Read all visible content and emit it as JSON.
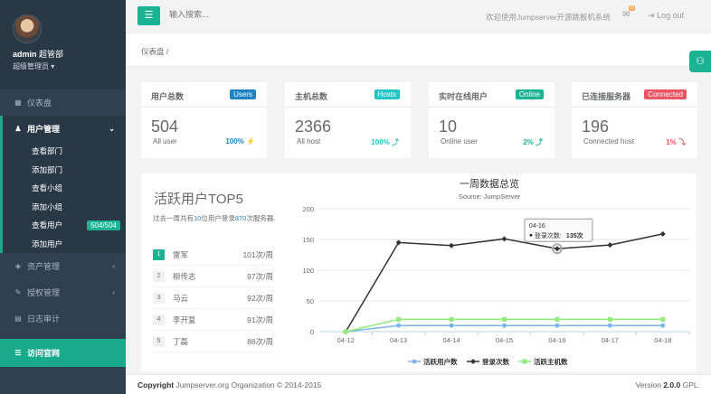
{
  "profile": {
    "name": "admin",
    "dept": "超管部",
    "role": "超级管理员"
  },
  "sidebar": {
    "dashboard": "仪表盘",
    "user_mgmt": "用户管理",
    "sub_items": [
      {
        "label": "查看部门",
        "badge": ""
      },
      {
        "label": "添加部门",
        "badge": ""
      },
      {
        "label": "查看小组",
        "badge": ""
      },
      {
        "label": "添加小组",
        "badge": ""
      },
      {
        "label": "查看用户",
        "badge": "504/504"
      },
      {
        "label": "添加用户",
        "badge": ""
      }
    ],
    "asset_mgmt": "资产管理",
    "perm_mgmt": "授权管理",
    "audit": "日志审计",
    "official": "访问官网"
  },
  "topbar": {
    "search_placeholder": "输入搜索...",
    "welcome": "欢迎使用Jumpserver开源跳板机系统",
    "mail_count": "0",
    "logout": "Log out"
  },
  "breadcrumb": "仪表盘 /",
  "cards": [
    {
      "title": "用户总数",
      "label": "Users",
      "label_color": "#1c84c6",
      "value": "504",
      "sub": "All user",
      "pct": "100%",
      "pct_icon": "⚡",
      "pct_color": "#1c84c6"
    },
    {
      "title": "主机总数",
      "label": "Hosts",
      "label_color": "#23c6c8",
      "value": "2366",
      "sub": "All host",
      "pct": "100%",
      "pct_icon": "⤴",
      "pct_color": "#23c6c8"
    },
    {
      "title": "实时在线用户",
      "label": "Online",
      "label_color": "#1ab394",
      "value": "10",
      "sub": "Online user",
      "pct": "2%",
      "pct_icon": "⤴",
      "pct_color": "#1ab394"
    },
    {
      "title": "已连接服务器",
      "label": "Connected",
      "label_color": "#ed5565",
      "value": "196",
      "sub": "Connected host",
      "pct": "1%",
      "pct_icon": "⤵",
      "pct_color": "#ed5565"
    }
  ],
  "top5": {
    "title": "活跃用户TOP5",
    "desc_pre": "过去一周共有",
    "desc_users": "10",
    "desc_mid": "位用户登录",
    "desc_times": "870",
    "desc_post": "次服务器.",
    "rows": [
      {
        "rank": "1",
        "name": "雷军",
        "count": "101次/周"
      },
      {
        "rank": "2",
        "name": "柳传志",
        "count": "97次/周"
      },
      {
        "rank": "3",
        "name": "马云",
        "count": "92次/周"
      },
      {
        "rank": "4",
        "name": "李开复",
        "count": "91次/周"
      },
      {
        "rank": "5",
        "name": "丁磊",
        "count": "88次/周"
      }
    ]
  },
  "chart_data": {
    "type": "line",
    "title": "一周数据总览",
    "subtitle": "Source: JumpServer",
    "categories": [
      "04-12",
      "04-13",
      "04-14",
      "04-15",
      "04-16",
      "04-17",
      "04-18"
    ],
    "ylim": [
      0,
      200
    ],
    "yticks": [
      0,
      50,
      100,
      150,
      200
    ],
    "grid": true,
    "legend_position": "bottom",
    "series": [
      {
        "name": "活跃用户数",
        "color": "#7cb5ec",
        "values": [
          0,
          10,
          10,
          10,
          10,
          10,
          10
        ]
      },
      {
        "name": "登录次数",
        "color": "#2f3439",
        "values": [
          0,
          145,
          140,
          151,
          135,
          141,
          159
        ]
      },
      {
        "name": "活跃主机数",
        "color": "#90ed7d",
        "values": [
          0,
          20,
          20,
          20,
          20,
          20,
          20
        ]
      }
    ],
    "tooltip": {
      "category": "04-16",
      "series": "登录次数",
      "label": "登录次数:",
      "value": "135次"
    }
  },
  "footer": {
    "copyright_pre": "Copyright",
    "copyright_text": "Jumpserver.org Organization © 2014-2015",
    "version_pre": "Version",
    "version_num": "2.0.0",
    "version_post": "GPL."
  }
}
